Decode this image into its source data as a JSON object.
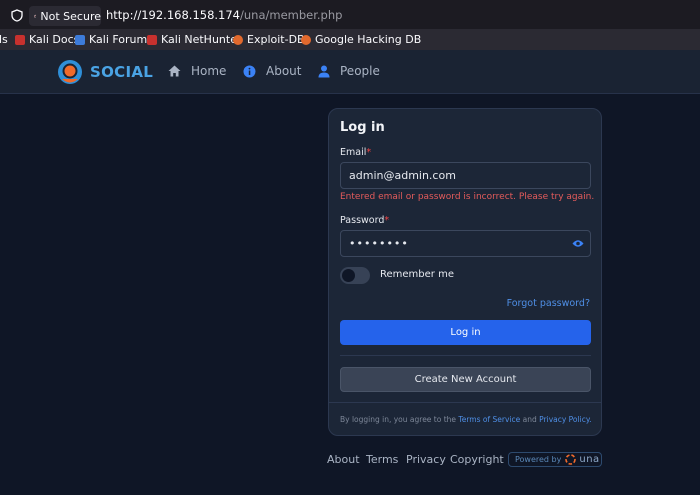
{
  "browser": {
    "not_secure": "Not Secure",
    "url_host": "http://192.168.158.174",
    "url_path": "/una/member.php",
    "bookmarks": [
      "ls",
      "Kali Docs",
      "Kali Forums",
      "Kali NetHunter",
      "Exploit-DB",
      "Google Hacking DB"
    ]
  },
  "header": {
    "brand": "SOCIAL",
    "nav": [
      "Home",
      "About",
      "People"
    ]
  },
  "login": {
    "title": "Log in",
    "email_label": "Email",
    "email_value": "admin@admin.com",
    "error": "Entered email or password is incorrect. Please try again.",
    "password_label": "Password",
    "password_value": "••••••••",
    "remember": "Remember me",
    "forgot": "Forgot password?",
    "login_button": "Log in",
    "create_button": "Create New Account",
    "terms_prefix": "By logging in, you agree to the",
    "terms_link": "Terms of Service",
    "and": "and",
    "privacy_link": "Privacy Policy."
  },
  "footer": {
    "links": [
      "About",
      "Terms",
      "Privacy",
      "Copyright"
    ],
    "powered": "Powered by",
    "una": "una"
  },
  "colors": {
    "accent": "#2563eb",
    "error": "#e35b5b",
    "link": "#4f8fe6"
  }
}
